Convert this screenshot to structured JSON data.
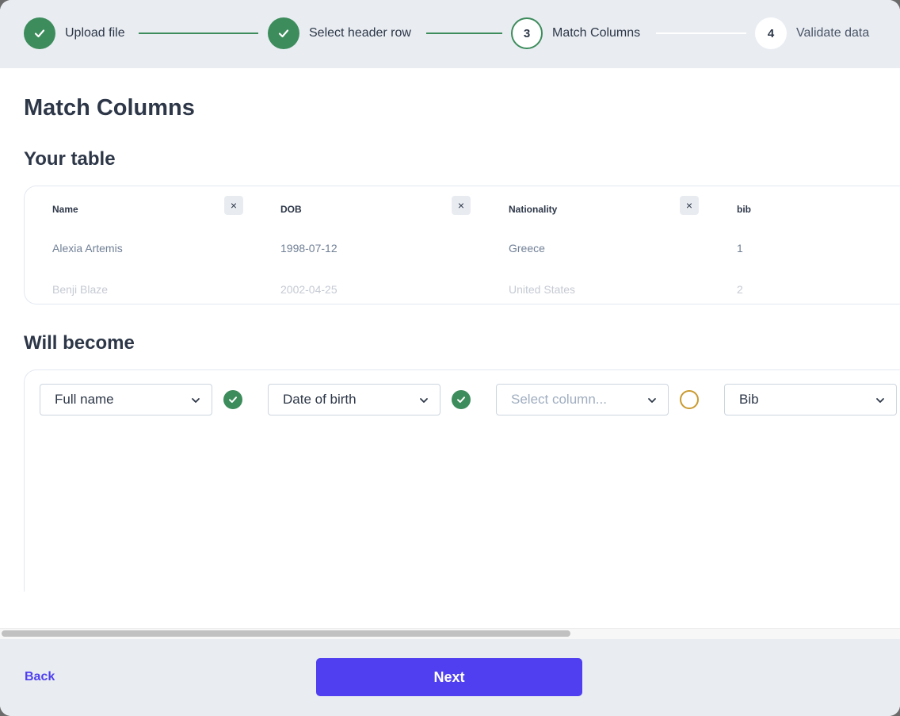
{
  "steps": [
    {
      "label": "Upload file",
      "state": "done",
      "number": "1"
    },
    {
      "label": "Select header row",
      "state": "done",
      "number": "2"
    },
    {
      "label": "Match Columns",
      "state": "active",
      "number": "3"
    },
    {
      "label": "Validate data",
      "state": "pending",
      "number": "4"
    }
  ],
  "page_title": "Match Columns",
  "your_table": {
    "heading": "Your table",
    "columns": [
      "Name",
      "DOB",
      "Nationality",
      "bib"
    ],
    "remove_icon": "×",
    "rows": [
      [
        "Alexia Artemis",
        "1998-07-12",
        "Greece",
        "1"
      ],
      [
        "Benji Blaze",
        "2002-04-25",
        "United States",
        "2"
      ]
    ]
  },
  "will_become": {
    "heading": "Will become",
    "mappings": [
      {
        "value": "Full name",
        "status": "matched"
      },
      {
        "value": "Date of birth",
        "status": "matched"
      },
      {
        "value": "Select column...",
        "status": "unmatched"
      },
      {
        "value": "Bib",
        "status": "none"
      }
    ]
  },
  "footer": {
    "back_label": "Back",
    "next_label": "Next"
  },
  "colors": {
    "success": "#3d8c5c",
    "warning": "#c99a2e",
    "primary": "#4f3ff0"
  }
}
